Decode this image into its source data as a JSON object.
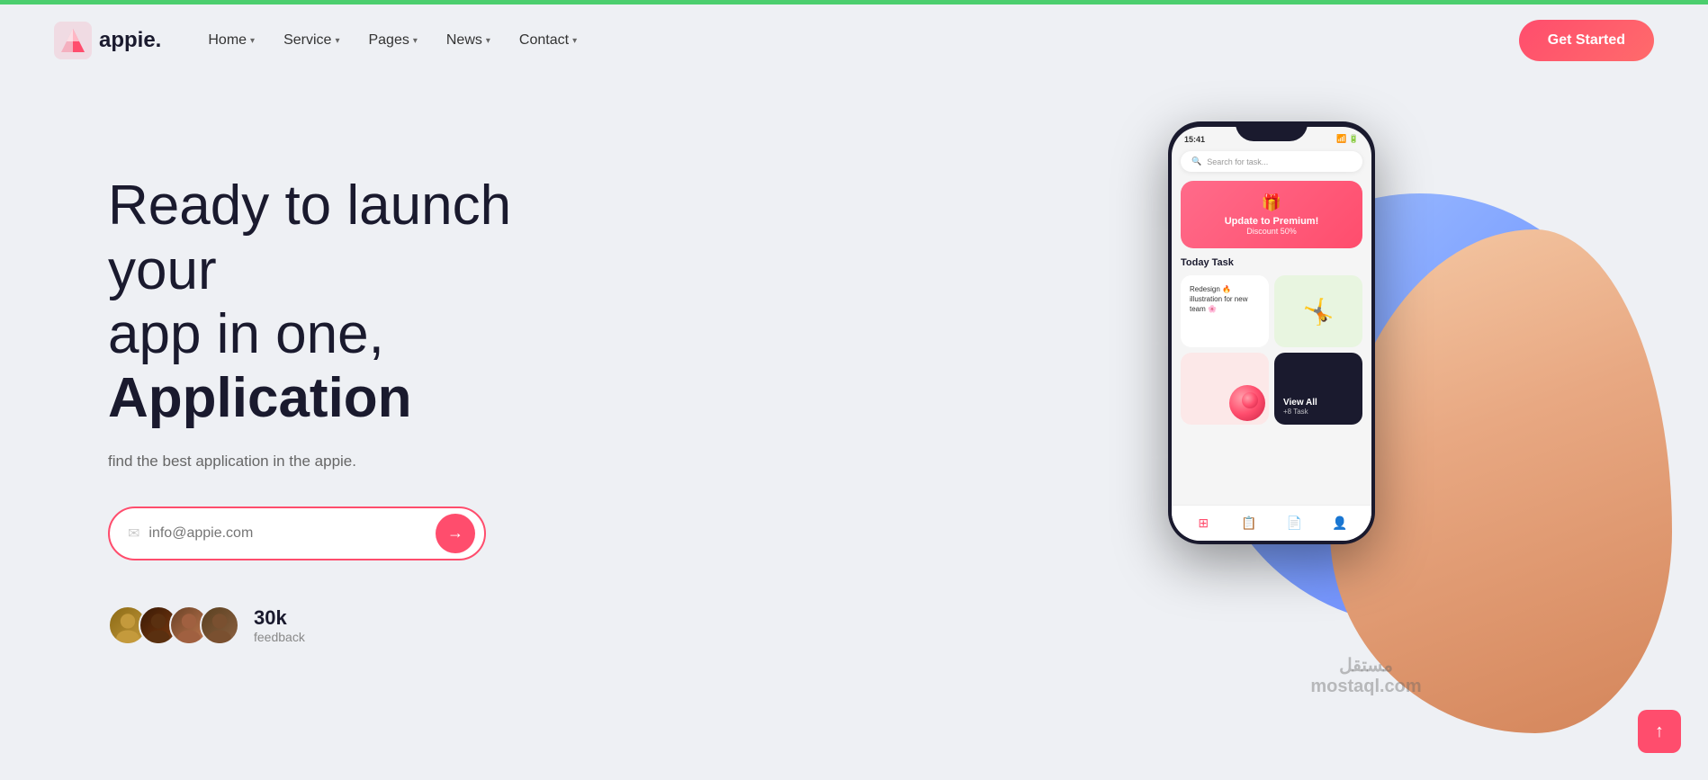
{
  "topbar": {},
  "nav": {
    "logo_text": "appie.",
    "links": [
      {
        "label": "Home",
        "has_dropdown": true
      },
      {
        "label": "Service",
        "has_dropdown": true
      },
      {
        "label": "Pages",
        "has_dropdown": true
      },
      {
        "label": "News",
        "has_dropdown": true
      },
      {
        "label": "Contact",
        "has_dropdown": true
      }
    ],
    "cta_label": "Get Started"
  },
  "hero": {
    "title_line1": "Ready to launch your",
    "title_line2": "app in one,",
    "title_bold": "Application",
    "subtitle": "find the best application in the appie.",
    "email_placeholder": "info@appie.com",
    "feedback_count": "30k",
    "feedback_label": "feedback"
  },
  "phone": {
    "time": "15:41",
    "search_placeholder": "Search for task...",
    "promo_emoji": "🎁",
    "promo_title": "Update to Premium!",
    "promo_sub": "Discount 50%",
    "today_label": "Today Task",
    "task1_text": "Redesign 🔥 illustration for new team 🌸",
    "view_all": "View All",
    "plus_task": "+8 Task"
  },
  "watermark": {
    "line1": "مستقل",
    "line2": "mostaql.com"
  },
  "scroll_top": "↑"
}
